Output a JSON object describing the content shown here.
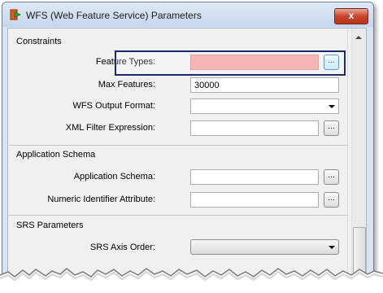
{
  "window": {
    "title": "WFS (Web Feature Service) Parameters",
    "close_glyph": "x"
  },
  "constraints": {
    "section_title": "Constraints",
    "feature_types_label": "Feature Types:",
    "feature_types_value": "",
    "max_features_label": "Max Features:",
    "max_features_value": "30000",
    "output_format_label": "WFS Output Format:",
    "output_format_value": "",
    "xml_filter_label": "XML Filter Expression:",
    "xml_filter_value": ""
  },
  "application_schema": {
    "section_title": "Application Schema",
    "schema_label": "Application Schema:",
    "schema_value": "",
    "numeric_id_label": "Numeric Identifier Attribute:",
    "numeric_id_value": ""
  },
  "srs": {
    "section_title": "SRS Parameters",
    "axis_order_label": "SRS Axis Order:",
    "axis_order_value": ""
  },
  "ellipsis_label": "...",
  "colors": {
    "error_field": "#f4a3a3",
    "highlight_border": "#1d2a6a",
    "titlebar": "#c5d6ec"
  },
  "icons": {
    "app": "fme-workbench-icon",
    "scroll": "scroll-up-arrow"
  }
}
